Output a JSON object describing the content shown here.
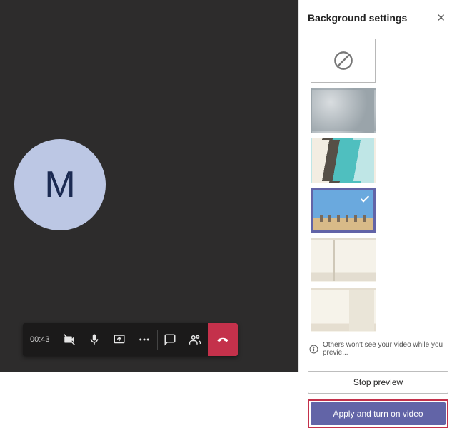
{
  "call": {
    "avatar_initial": "M",
    "timer": "00:43"
  },
  "panel": {
    "title": "Background settings",
    "info_text": "Others won't see your video while you previe...",
    "backgrounds": [
      {
        "id": "none",
        "label": "No background"
      },
      {
        "id": "blur",
        "label": "Blur"
      },
      {
        "id": "office",
        "label": "Office"
      },
      {
        "id": "beach",
        "label": "Beach",
        "selected": true
      },
      {
        "id": "room1",
        "label": "Room corner"
      },
      {
        "id": "room2",
        "label": "Room wall"
      }
    ],
    "stop_label": "Stop preview",
    "apply_label": "Apply and turn on video"
  }
}
